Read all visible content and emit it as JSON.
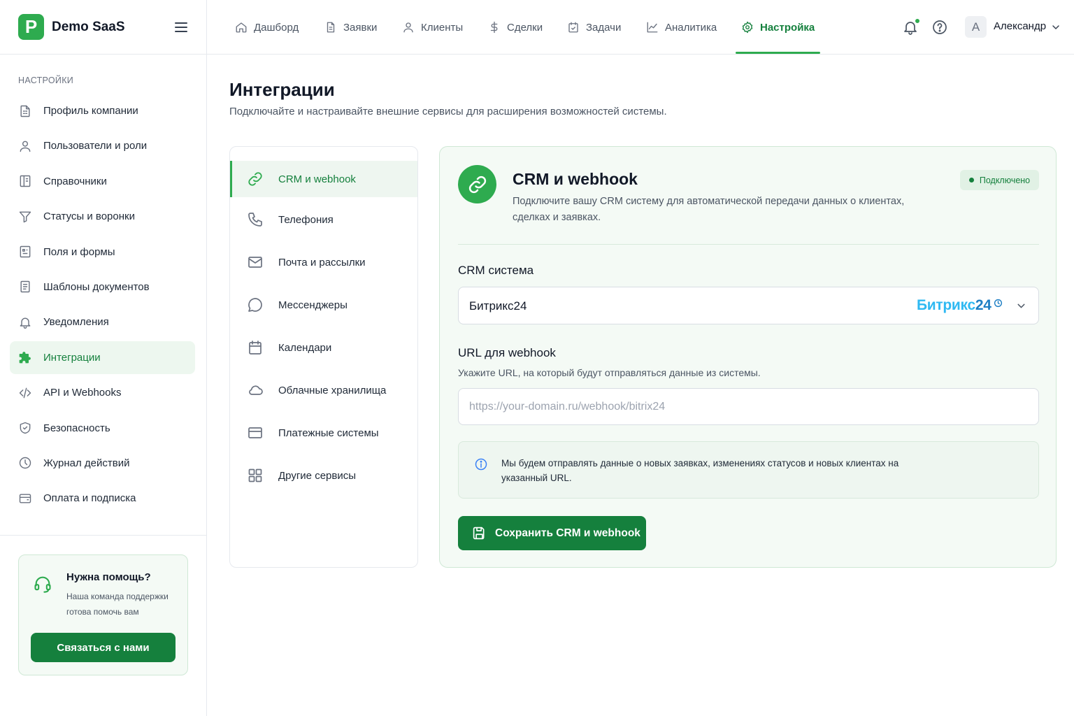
{
  "brand": {
    "logo_letter": "P",
    "name": "Demo SaaS"
  },
  "sidebar": {
    "section_title": "НАСТРОЙКИ",
    "items": [
      {
        "label": "Профиль компании",
        "icon": "building-doc-icon"
      },
      {
        "label": "Пользователи и роли",
        "icon": "user-icon"
      },
      {
        "label": "Справочники",
        "icon": "book-icon"
      },
      {
        "label": "Статусы и воронки",
        "icon": "funnel-icon"
      },
      {
        "label": "Поля и формы",
        "icon": "form-icon"
      },
      {
        "label": "Шаблоны документов",
        "icon": "document-icon"
      },
      {
        "label": "Уведомления",
        "icon": "bell-icon"
      },
      {
        "label": "Интеграции",
        "icon": "puzzle-icon",
        "active": true
      },
      {
        "label": "API и Webhooks",
        "icon": "code-icon"
      },
      {
        "label": "Безопасность",
        "icon": "shield-icon"
      },
      {
        "label": "Журнал действий",
        "icon": "clock-icon"
      },
      {
        "label": "Оплата и подписка",
        "icon": "wallet-icon"
      }
    ],
    "help": {
      "title": "Нужна помощь?",
      "text": "Наша команда поддержки готова помочь вам",
      "button": "Связаться с нами"
    }
  },
  "topnav": {
    "tabs": [
      {
        "label": "Дашборд",
        "icon": "home-icon"
      },
      {
        "label": "Заявки",
        "icon": "file-icon"
      },
      {
        "label": "Клиенты",
        "icon": "user-icon"
      },
      {
        "label": "Сделки",
        "icon": "dollar-icon"
      },
      {
        "label": "Задачи",
        "icon": "calendar-check-icon"
      },
      {
        "label": "Аналитика",
        "icon": "chart-line-icon"
      },
      {
        "label": "Настройка",
        "icon": "gear-icon",
        "active": true
      }
    ],
    "user": {
      "initial": "A",
      "name": "Александр"
    }
  },
  "page": {
    "title": "Интеграции",
    "subtitle": "Подключайте  и настраивайте внешние сервисы для расширения возможностей системы."
  },
  "integrations": [
    {
      "label": "CRM и webhook",
      "icon": "link-icon",
      "active": true
    },
    {
      "label": "Телефония",
      "icon": "phone-icon"
    },
    {
      "label": "Почта и рассылки",
      "icon": "mail-icon"
    },
    {
      "label": "Мессенджеры",
      "icon": "chat-icon"
    },
    {
      "label": "Календари",
      "icon": "calendar-icon"
    },
    {
      "label": "Облачные хранилища",
      "icon": "cloud-icon"
    },
    {
      "label": "Платежные системы",
      "icon": "card-icon"
    },
    {
      "label": "Другие сервисы",
      "icon": "grid-icon"
    }
  ],
  "panel": {
    "title": "CRM и webhook",
    "description": "Подключите вашу CRM систему для автоматической передачи данных о клиентах, сделках и заявках.",
    "status": "Подключено",
    "crm_label": "CRM система",
    "crm_value": "Битрикс24",
    "crm_logo_text": "Битрикс",
    "crm_logo_num": "24",
    "url_label": "URL для webhook",
    "url_hint": "Укажите URL, на который будут отправляться данные из системы.",
    "url_value": "",
    "url_placeholder": "https://your-domain.ru/webhook/bitrix24",
    "info": "Мы будем отправлять данные о новых заявках, изменениях статусов и новых клиентах на указанный URL.",
    "save_button": "Сохранить CRM и webhook"
  },
  "colors": {
    "accent": "#2eab4f",
    "accent_dark": "#15803d",
    "panel_bg": "#f4faf5",
    "bitrix_blue": "#2fb9f2"
  }
}
